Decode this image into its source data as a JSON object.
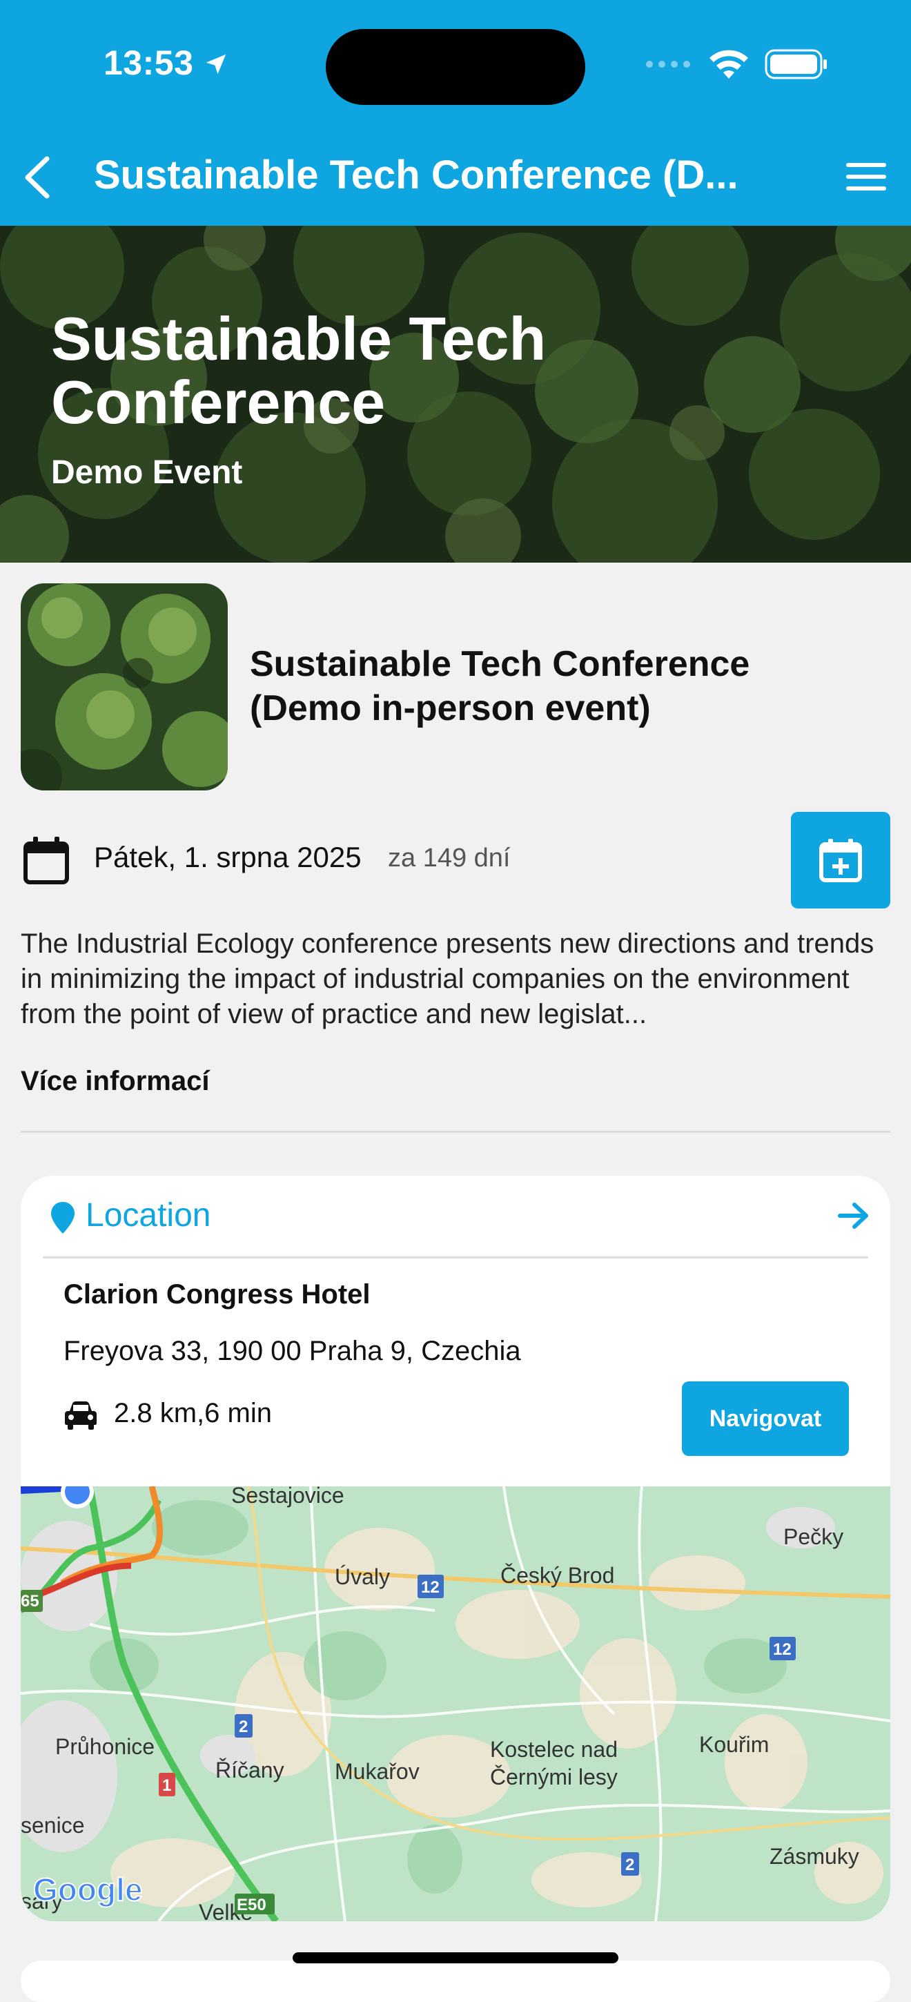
{
  "status_bar": {
    "time": "13:53"
  },
  "nav": {
    "title": "Sustainable Tech Conference (D...",
    "back_icon": "chevron-left-icon",
    "menu_icon": "hamburger-menu-icon"
  },
  "hero": {
    "title": "Sustainable Tech Conference",
    "subtitle": "Demo Event"
  },
  "event": {
    "name": "Sustainable Tech Conference (Demo in-person event)",
    "date": "Pátek, 1. srpna 2025",
    "countdown": "za 149 dní",
    "description": "The Industrial Ecology conference presents new directions and trends in minimizing the impact of industrial companies on the environment from the point of view of practice and new legislat...",
    "more_label": "Více informací"
  },
  "location": {
    "title": "Location",
    "venue": "Clarion Congress Hotel",
    "address": "Freyova 33, 190 00 Praha 9, Czechia",
    "distance": "2.8 km,6 min",
    "navigate_label": "Navigovat"
  },
  "map": {
    "labels": {
      "sestajovice": "Sestajovice",
      "pecky": "Pečky",
      "uvaly": "Úvaly",
      "cesky_brod": "Český Brod",
      "pruhonice": "Průhonice",
      "ricany": "Říčany",
      "mukarov": "Mukařov",
      "kostelec_1": "Kostelec nad",
      "kostelec_2": "Černými lesy",
      "kourim": "Kouřim",
      "zasmuky": "Zásmuky",
      "senice": "senice",
      "velke": "Velké",
      "sary": "sary",
      "road_12": "12",
      "road_2": "2",
      "road_1": "1",
      "road_65": "65",
      "road_e50": "E50",
      "attribution": "Google"
    }
  },
  "colors": {
    "accent": "#0ea5e0",
    "background": "#f1f1f1"
  }
}
